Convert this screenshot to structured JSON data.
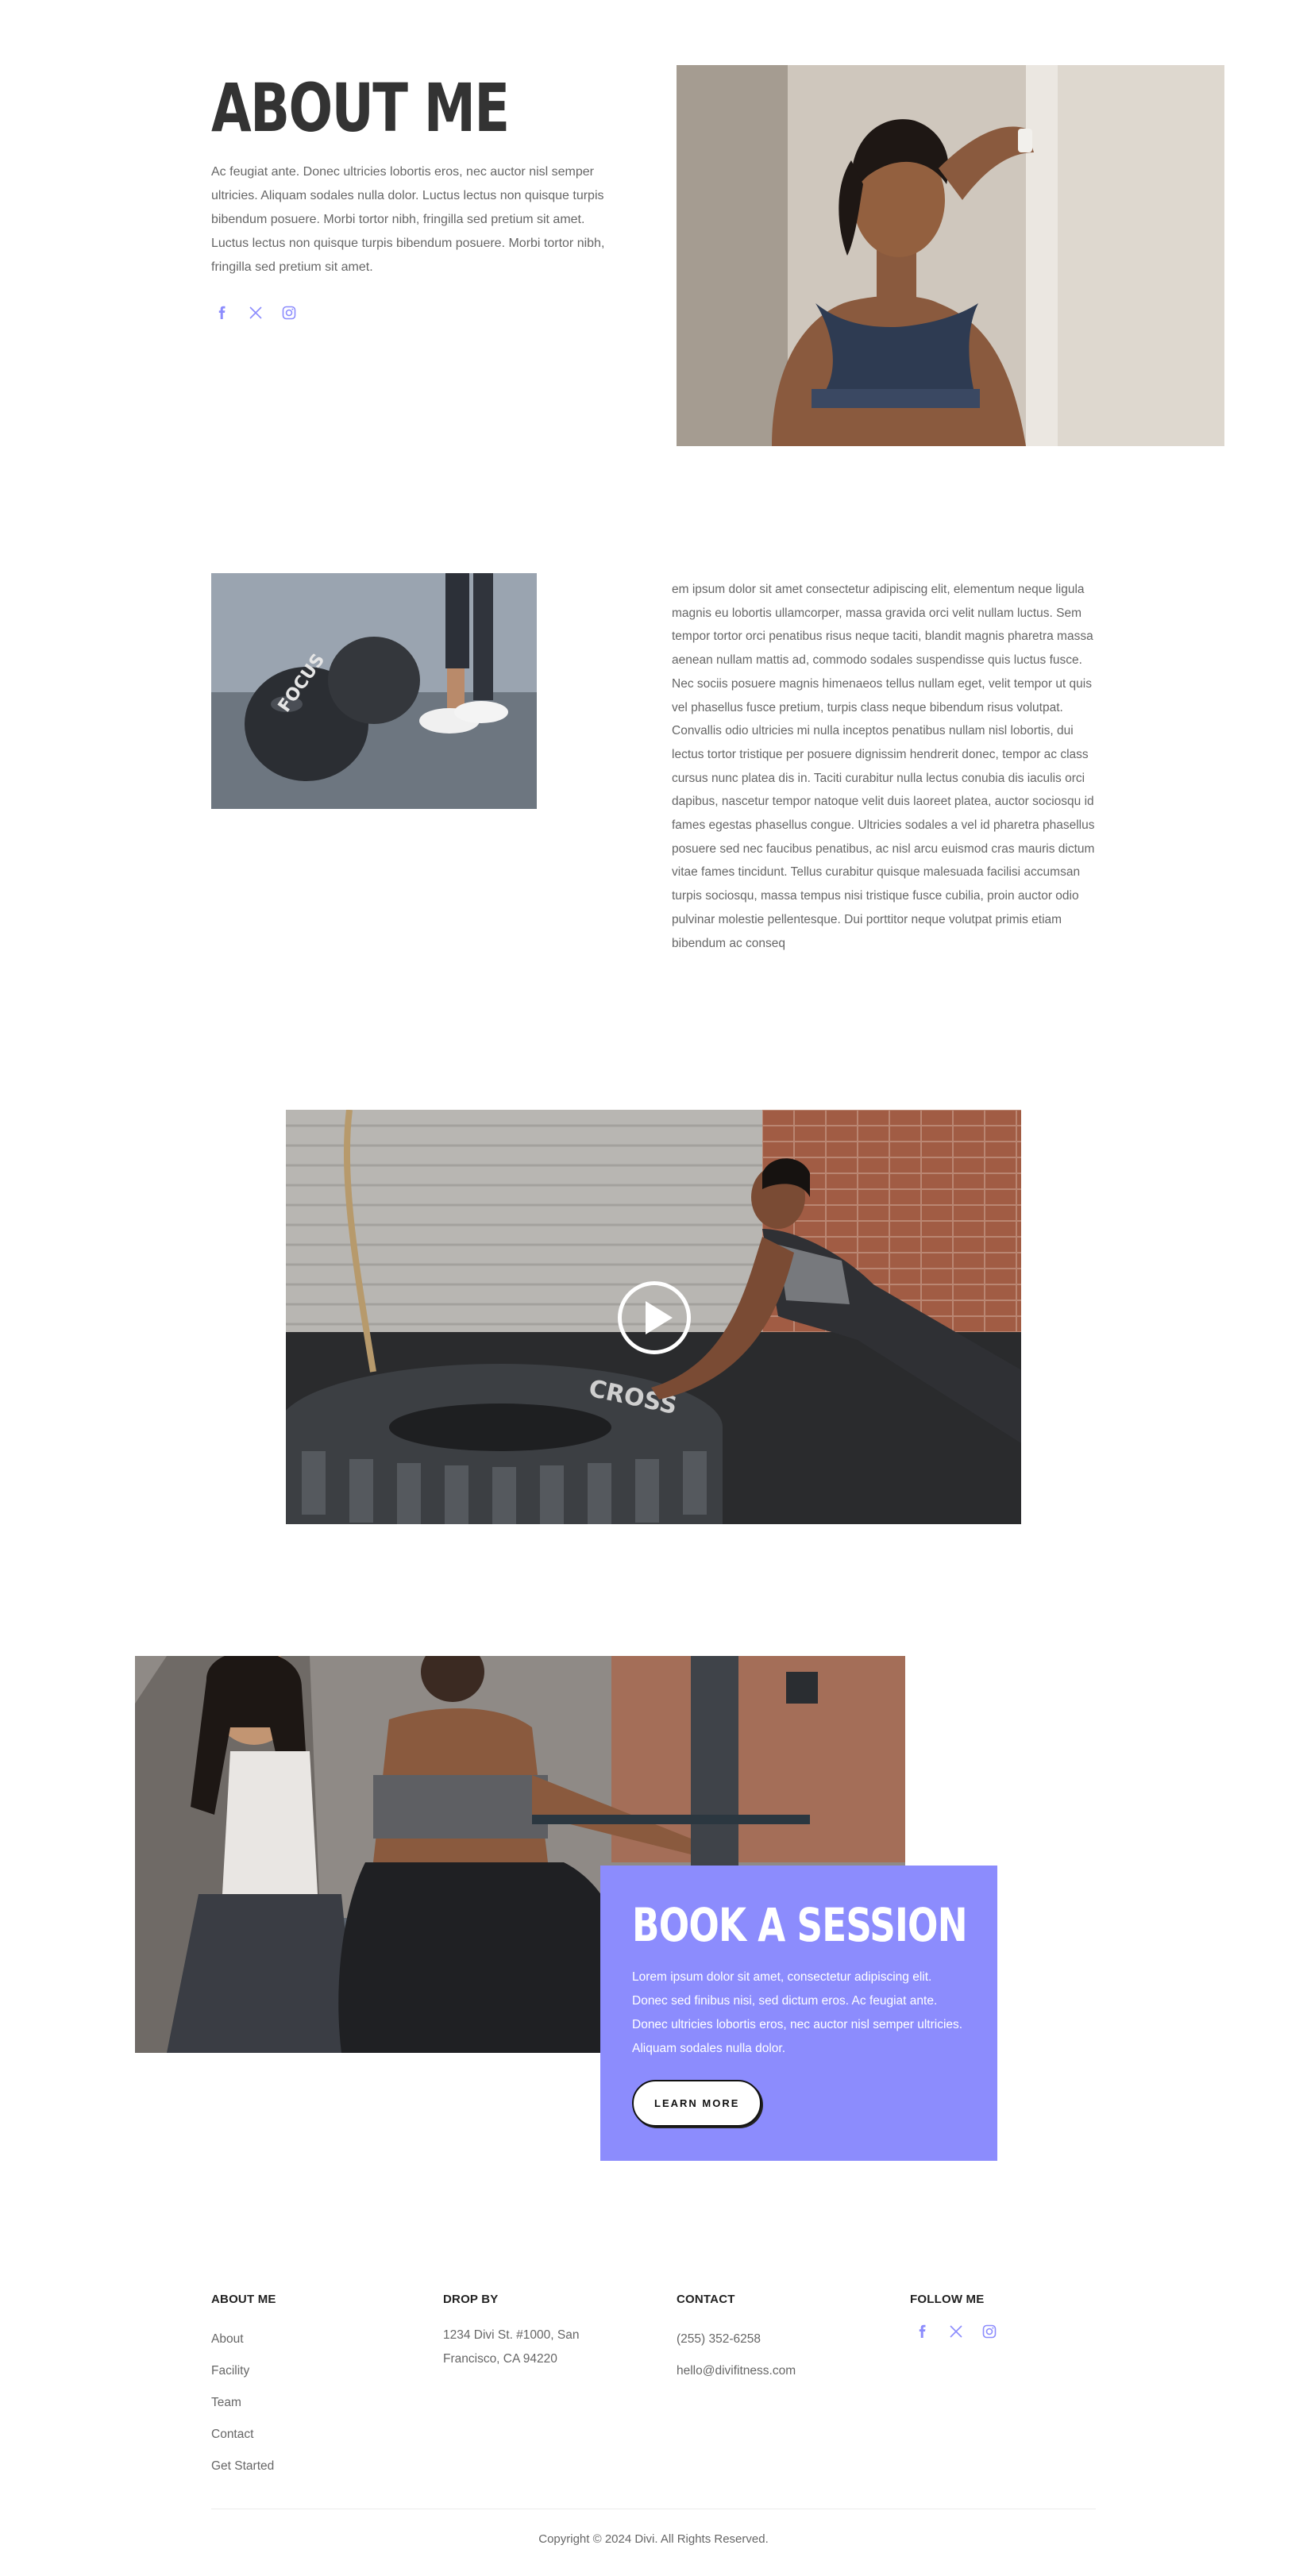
{
  "about": {
    "title": "ABOUT ME",
    "text": "Ac feugiat ante. Donec ultricies lobortis eros, nec auctor nisl semper ultricies. Aliquam sodales nulla dolor. Luctus lectus non quisque turpis bibendum posuere. Morbi tortor nibh, fringilla sed pretium sit amet. Luctus lectus non quisque turpis bibendum posuere. Morbi tortor nibh, fringilla sed pretium sit amet.",
    "social": [
      "facebook-icon",
      "x-icon",
      "instagram-icon"
    ]
  },
  "story": {
    "text": "em ipsum dolor sit amet consectetur adipiscing elit, elementum neque ligula magnis eu lobortis ullamcorper, massa gravida orci velit nullam luctus. Sem tempor tortor orci penatibus risus neque taciti, blandit magnis pharetra massa aenean nullam mattis ad, commodo sodales suspendisse quis luctus fusce. Nec sociis posuere magnis himenaeos tellus nullam eget, velit tempor ut quis vel phasellus fusce pretium, turpis class neque bibendum risus volutpat. Convallis odio ultricies mi nulla inceptos penatibus nullam nisl lobortis, dui lectus tortor tristique per posuere dignissim hendrerit donec, tempor ac class cursus nunc platea dis in. Taciti curabitur nulla lectus conubia dis iaculis orci dapibus, nascetur tempor natoque velit duis laoreet platea, auctor sociosqu id fames egestas phasellus congue. Ultricies sodales a vel id pharetra phasellus posuere sed nec faucibus penatibus, ac nisl arcu euismod cras mauris dictum vitae fames tincidunt. Tellus curabitur quisque malesuada facilisi accumsan turpis sociosqu, massa tempus nisi tristique fusce cubilia, proin auctor odio pulvinar molestie pellentesque. Dui porttitor neque volutpat primis etiam bibendum ac conseq",
    "ball_label": "FOCUS"
  },
  "video": {
    "tire_text": "CROSS",
    "play_icon": "play-icon"
  },
  "book": {
    "title": "BOOK A SESSION",
    "text": "Lorem ipsum dolor sit amet, consectetur adipiscing elit. Donec sed finibus nisi, sed dictum eros. Ac feugiat ante. Donec ultricies lobortis eros, nec auctor nisl semper ultricies. Aliquam sodales nulla dolor.",
    "button": "LEARN MORE",
    "card_color": "#8c8cfd"
  },
  "footer": {
    "about": {
      "heading": "ABOUT ME",
      "links": [
        "About",
        "Facility",
        "Team",
        "Contact",
        "Get Started"
      ]
    },
    "drop_by": {
      "heading": "DROP BY",
      "address": "1234 Divi St. #1000, San Francisco, CA 94220"
    },
    "contact": {
      "heading": "CONTACT",
      "phone": "(255) 352-6258",
      "email": "hello@divifitness.com"
    },
    "follow": {
      "heading": "FOLLOW ME",
      "social": [
        "facebook-icon",
        "x-icon",
        "instagram-icon"
      ]
    },
    "copyright": "Copyright © 2024 Divi. All Rights Reserved."
  },
  "colors": {
    "accent": "#8c8cfd",
    "heading": "#333333",
    "body_text": "#666666"
  }
}
